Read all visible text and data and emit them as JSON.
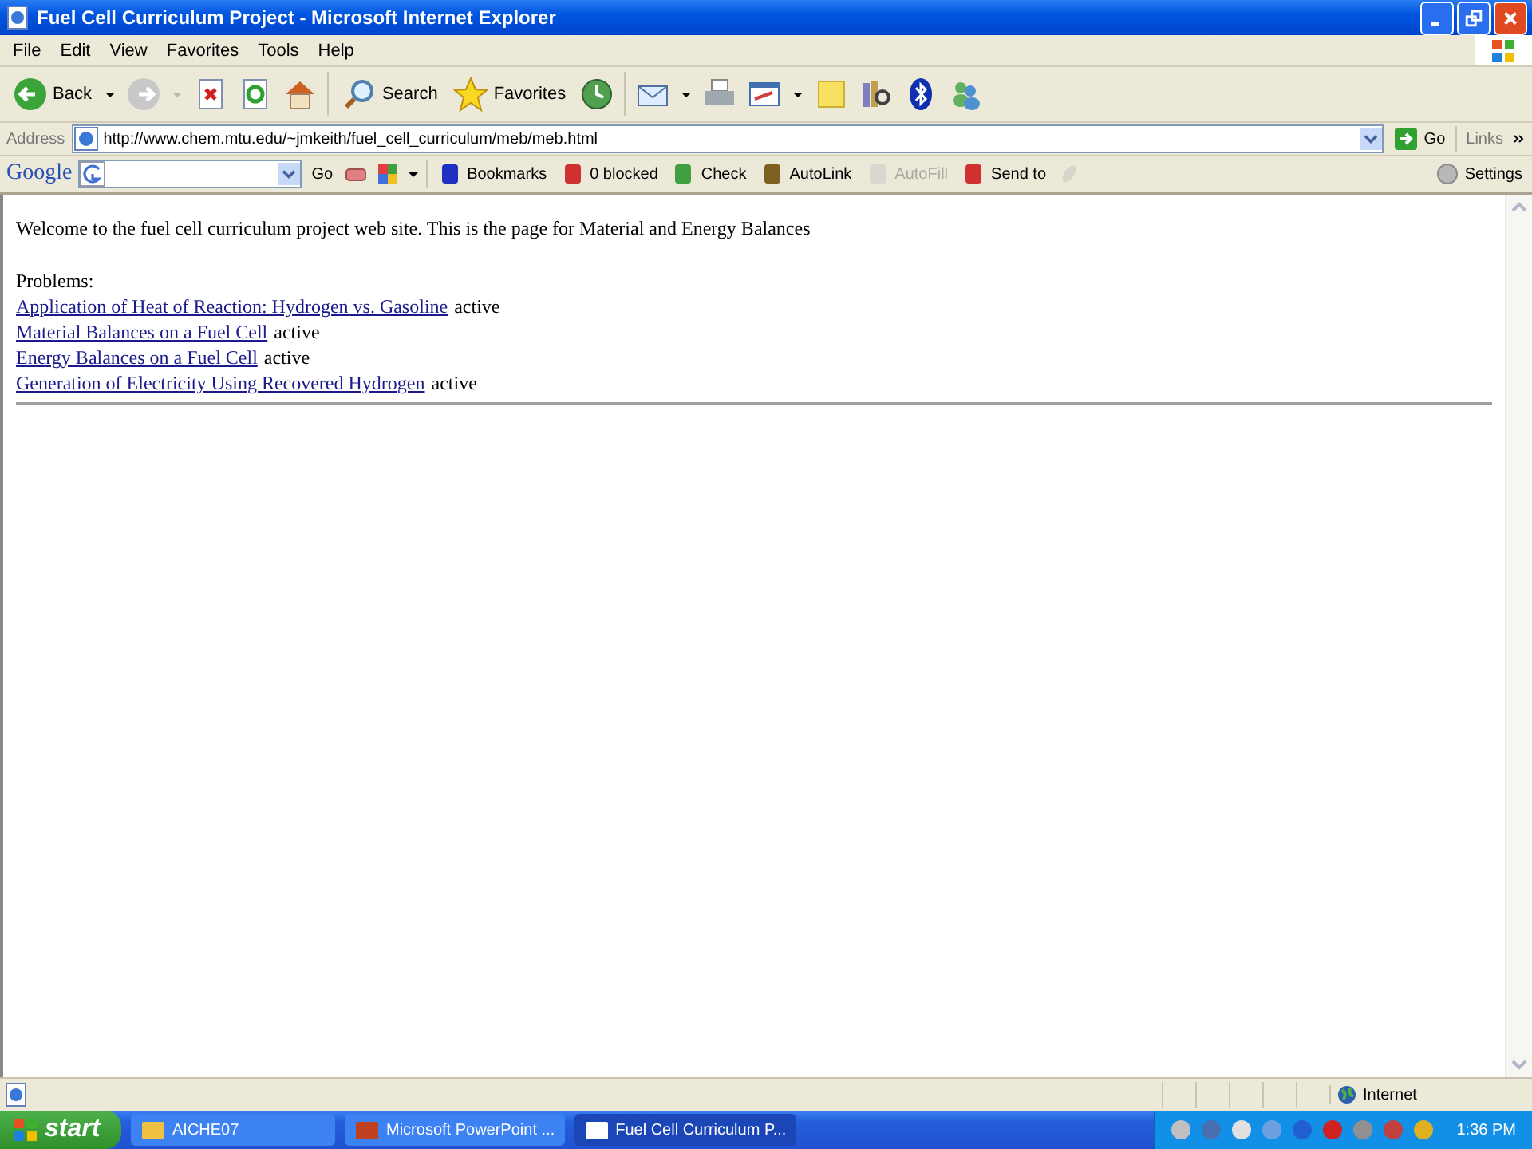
{
  "window": {
    "title": "Fuel Cell Curriculum Project - Microsoft Internet Explorer"
  },
  "menu": [
    "File",
    "Edit",
    "View",
    "Favorites",
    "Tools",
    "Help"
  ],
  "toolbar": {
    "back": "Back",
    "search": "Search",
    "favorites": "Favorites"
  },
  "address": {
    "label": "Address",
    "url": "http://www.chem.mtu.edu/~jmkeith/fuel_cell_curriculum/meb/meb.html",
    "go": "Go",
    "links": "Links"
  },
  "google_toolbar": {
    "logo": "Google",
    "go": "Go",
    "items": [
      {
        "label": "Bookmarks",
        "disabled": false
      },
      {
        "label": "0 blocked",
        "disabled": false
      },
      {
        "label": "Check",
        "disabled": false
      },
      {
        "label": "AutoLink",
        "disabled": false
      },
      {
        "label": "AutoFill",
        "disabled": true
      },
      {
        "label": "Send to",
        "disabled": false
      }
    ],
    "settings": "Settings"
  },
  "page": {
    "welcome": "Welcome to the fuel cell curriculum project web site. This is the page for Material and Energy Balances",
    "problems_label": "Problems:",
    "problems": [
      {
        "link": "Application of Heat of Reaction: Hydrogen vs. Gasoline",
        "status": "active"
      },
      {
        "link": "Material Balances on a Fuel Cell",
        "status": "active"
      },
      {
        "link": "Energy Balances on a Fuel Cell",
        "status": "active"
      },
      {
        "link": "Generation of Electricity Using Recovered Hydrogen",
        "status": "active"
      }
    ]
  },
  "status_bar": {
    "zone": "Internet"
  },
  "taskbar": {
    "start": "start",
    "tasks": [
      {
        "label": "AICHE07",
        "selected": false
      },
      {
        "label": "Microsoft PowerPoint ...",
        "selected": false
      },
      {
        "label": "Fuel Cell Curriculum P...",
        "selected": true
      }
    ],
    "clock": "1:36 PM"
  }
}
